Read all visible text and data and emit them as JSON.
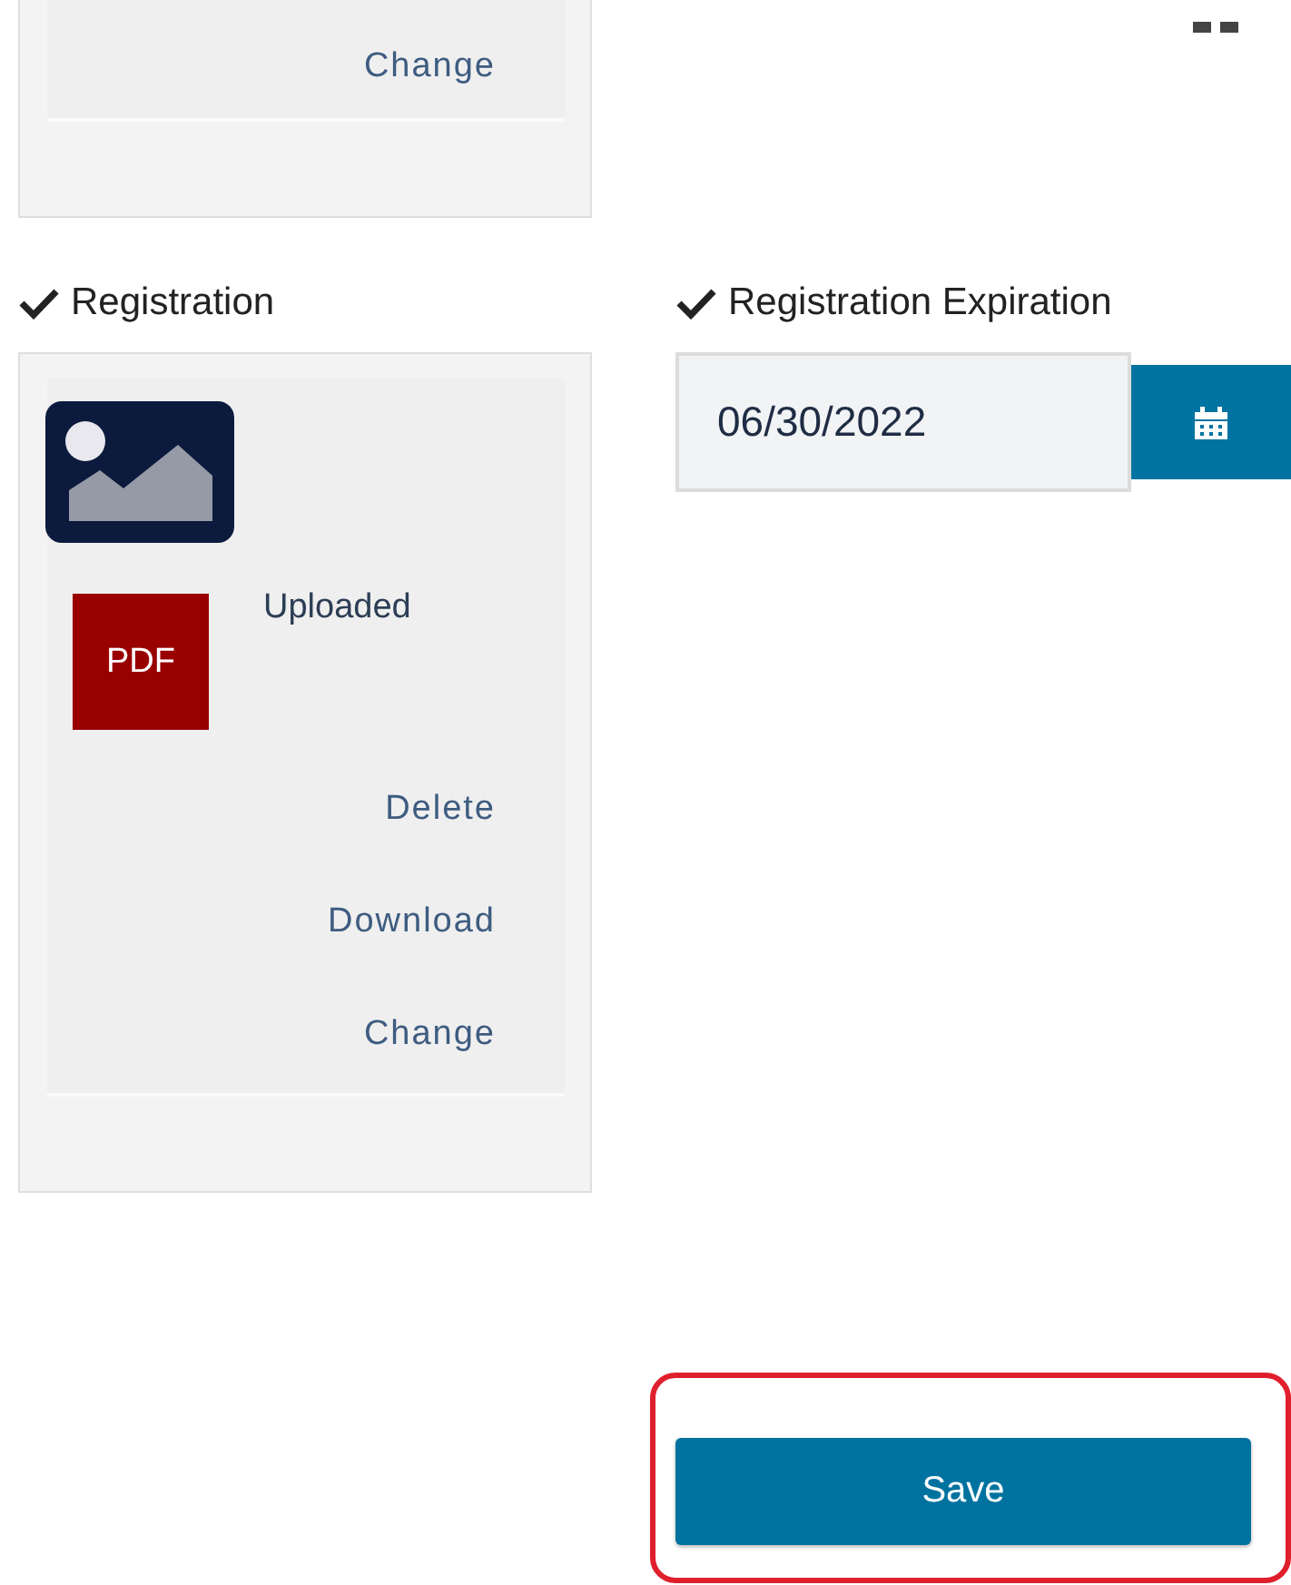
{
  "previous_upload": {
    "links": [
      "Change"
    ]
  },
  "registration": {
    "label": "Registration",
    "checked": true,
    "status": "Uploaded",
    "file_type": "PDF",
    "links": [
      "Delete",
      "Download",
      "Change"
    ]
  },
  "registration_expiration": {
    "label": "Registration Expiration",
    "checked": true,
    "value": "06/30/2022"
  },
  "save": {
    "label": "Save",
    "highlighted": true
  }
}
